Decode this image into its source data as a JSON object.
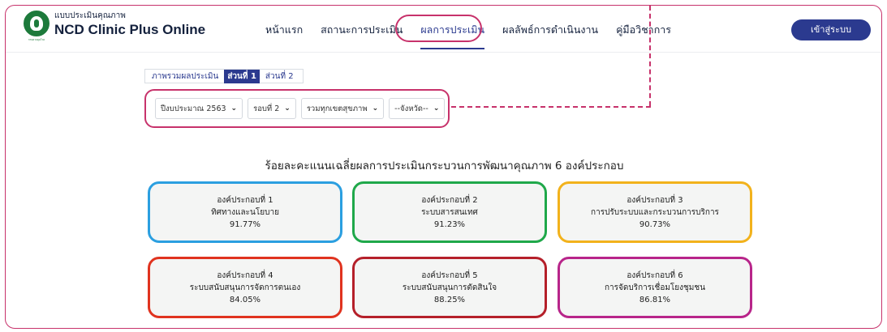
{
  "header": {
    "brand_sub": "แบบประเมินคุณภาพ",
    "brand_title": "NCD Clinic Plus Online",
    "logo_caption": "กรมควบคุมโรค",
    "nav": [
      {
        "label": "หน้าแรก"
      },
      {
        "label": "สถานะการประเมิน"
      },
      {
        "label": "ผลการประเมิน"
      },
      {
        "label": "ผลลัพธ์การดำเนินงาน"
      },
      {
        "label": "คู่มือวิชาการ"
      }
    ],
    "login_label": "เข้าสู่ระบบ"
  },
  "subtabs": {
    "items": [
      {
        "label": "ภาพรวมผลประเมิน"
      },
      {
        "label": "ส่วนที่ 1"
      },
      {
        "label": "ส่วนที่ 2"
      }
    ]
  },
  "filters": {
    "year": "ปีงบประมาณ 2563",
    "round": "รอบที่ 2",
    "region": "รวมทุกเขตสุขภาพ",
    "province": "--จังหวัด--"
  },
  "heading": "ร้อยละคะแนนเฉลี่ยผลการประเมินกระบวนการพัฒนาคุณภาพ 6 องค์ประกอบ",
  "cards": [
    {
      "title": "องค์ประกอบที่ 1",
      "name": "ทิศทางและนโยบาย",
      "value": "91.77%",
      "color": "#2b9fe0"
    },
    {
      "title": "องค์ประกอบที่ 2",
      "name": "ระบบสารสนเทศ",
      "value": "91.23%",
      "color": "#1fa84a"
    },
    {
      "title": "องค์ประกอบที่ 3",
      "name": "การปรับระบบและกระบวนการบริการ",
      "value": "90.73%",
      "color": "#f2b21c"
    },
    {
      "title": "องค์ประกอบที่ 4",
      "name": "ระบบสนับสนุนการจัดการตนเอง",
      "value": "84.05%",
      "color": "#e0331f"
    },
    {
      "title": "องค์ประกอบที่ 5",
      "name": "ระบบสนับสนุนการตัดสินใจ",
      "value": "88.25%",
      "color": "#b5202a"
    },
    {
      "title": "องค์ประกอบที่ 6",
      "name": "การจัดบริการเชื่อมโยงชุมชน",
      "value": "86.81%",
      "color": "#b8258a"
    }
  ],
  "colors": {
    "accent": "#c7326b",
    "primary": "#2b3a8f"
  }
}
